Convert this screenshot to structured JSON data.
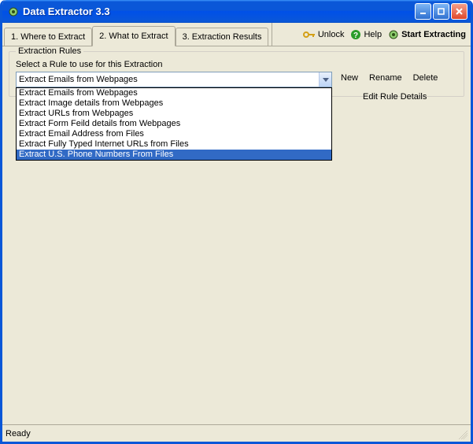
{
  "window": {
    "title": "Data Extractor 3.3"
  },
  "tabs": [
    {
      "label": "1. Where to Extract",
      "active": false
    },
    {
      "label": "2. What to Extract",
      "active": true
    },
    {
      "label": "3. Extraction Results",
      "active": false
    }
  ],
  "toolbar": {
    "unlock": "Unlock",
    "help": "Help",
    "start": "Start Extracting"
  },
  "group": {
    "title": "Extraction Rules",
    "label": "Select a Rule to use for this Extraction",
    "selected": "Extract Emails from Webpages",
    "options": [
      "Extract Emails from Webpages",
      "Extract Image details from Webpages",
      "Extract URLs from Webpages",
      "Extract Form Feild details from Webpages",
      "Extract Email Address from Files",
      "Extract Fully Typed Internet URLs from Files",
      "Extract U.S. Phone Numbers From Files"
    ],
    "highlighted_index": 6
  },
  "actions": {
    "new": "New",
    "rename": "Rename",
    "delete": "Delete",
    "edit": "Edit Rule Details"
  },
  "status": {
    "text": "Ready"
  }
}
